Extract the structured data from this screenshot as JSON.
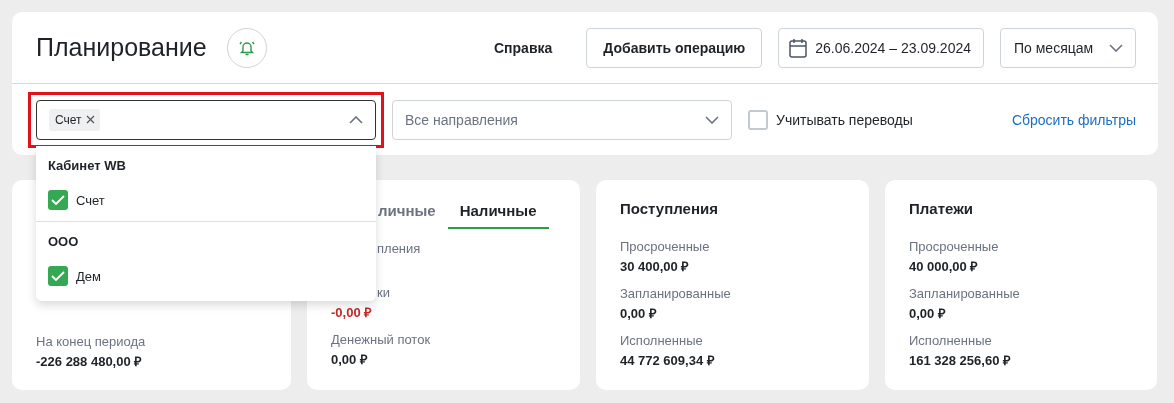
{
  "header": {
    "title": "Планирование",
    "help": "Справка",
    "add_button": "Добавить операцию",
    "date_range": "26.06.2024 – 23.09.2024",
    "period": "По месяцам"
  },
  "filters": {
    "account_select": {
      "tags": [
        "Счет"
      ],
      "expanded": true
    },
    "direction_select": {
      "placeholder": "Все направления"
    },
    "transfers": {
      "label": "Учитывать переводы",
      "checked": false
    },
    "reset_link": "Сбросить фильтры"
  },
  "dropdown": {
    "groups": [
      {
        "title": "Кабинет WB",
        "options": [
          {
            "label": "Счет",
            "checked": true
          }
        ]
      },
      {
        "title": "ООО",
        "options": [
          {
            "label": "Дем",
            "checked": true
          }
        ]
      }
    ]
  },
  "cards": [
    {
      "items": [
        {
          "label": "На конец периода",
          "value": "-226 288 480,00 ₽"
        }
      ]
    },
    {
      "tabs": [
        {
          "label": "личные",
          "selected": false,
          "partial": true
        },
        {
          "label": "Наличные",
          "selected": true
        }
      ],
      "items": [
        {
          "label": "пления",
          "partial": true
        },
        {
          "label": "ки",
          "value": "-0,00 ₽",
          "partial": true,
          "negative": true
        },
        {
          "label": "Денежный поток",
          "value": "0,00 ₽"
        }
      ]
    },
    {
      "title": "Поступления",
      "items": [
        {
          "label": "Просроченные",
          "value": "30 400,00 ₽"
        },
        {
          "label": "Запланированные",
          "value": "0,00 ₽"
        },
        {
          "label": "Исполненные",
          "value": "44 772 609,34 ₽"
        }
      ]
    },
    {
      "title": "Платежи",
      "items": [
        {
          "label": "Просроченные",
          "value": "40 000,00 ₽"
        },
        {
          "label": "Запланированные",
          "value": "0,00 ₽"
        },
        {
          "label": "Исполненные",
          "value": "161 328 256,60 ₽"
        }
      ]
    }
  ]
}
